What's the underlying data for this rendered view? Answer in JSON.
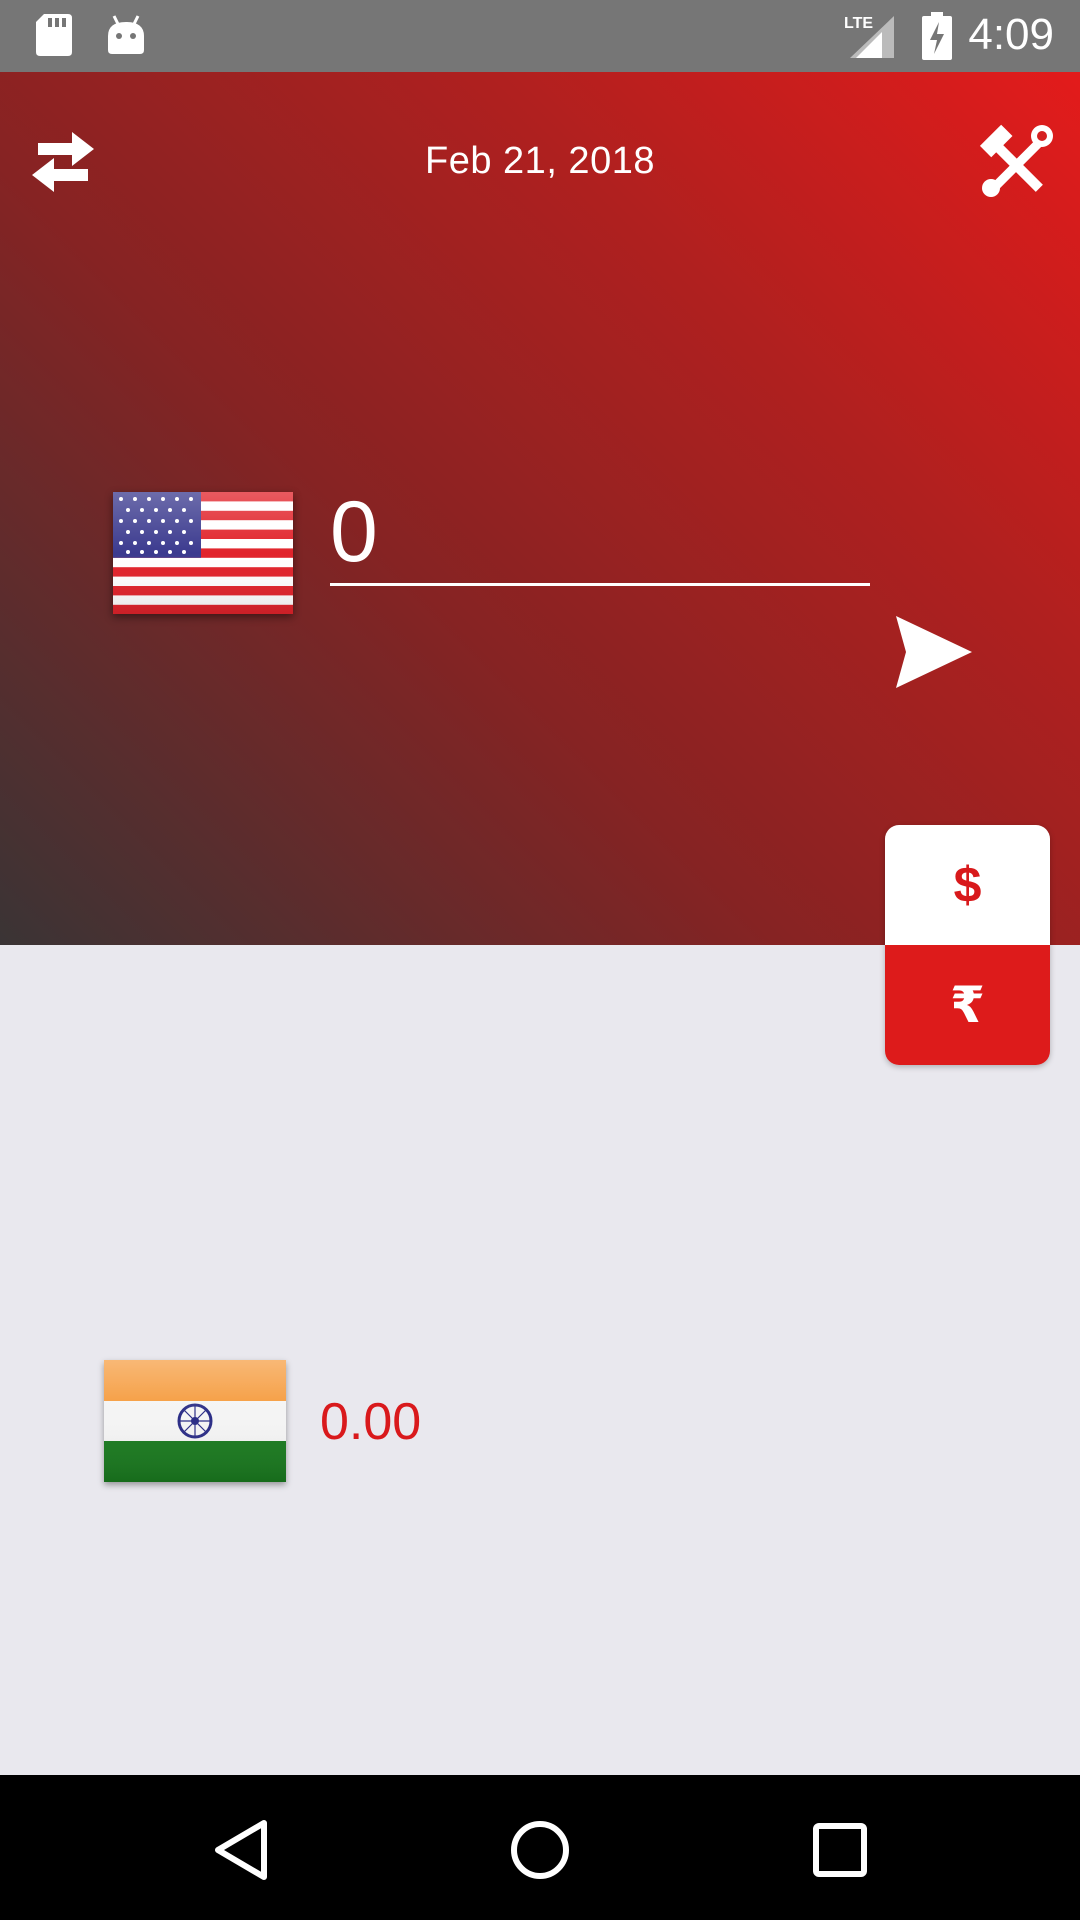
{
  "status_bar": {
    "time": "4:09",
    "network": "LTE",
    "icons": [
      "sd-card-icon",
      "android-icon",
      "signal-icon",
      "battery-charging-icon"
    ]
  },
  "header": {
    "date": "Feb 21, 2018",
    "left_icon": "swap-icon",
    "right_icon": "tools-icon"
  },
  "converter": {
    "from_currency": "USD",
    "from_flag": "us-flag",
    "input_value": "0",
    "send_icon": "send-icon",
    "to_currency": "INR",
    "to_flag": "india-flag",
    "result_value": "0.00"
  },
  "currency_toggle": {
    "top_symbol": "$",
    "bottom_symbol": "₹"
  },
  "colors": {
    "accent_red": "#dd1b1b",
    "result_red": "#d9191c",
    "background": "#e9e8ee"
  },
  "nav": {
    "buttons": [
      "back-icon",
      "home-icon",
      "recents-icon"
    ]
  }
}
